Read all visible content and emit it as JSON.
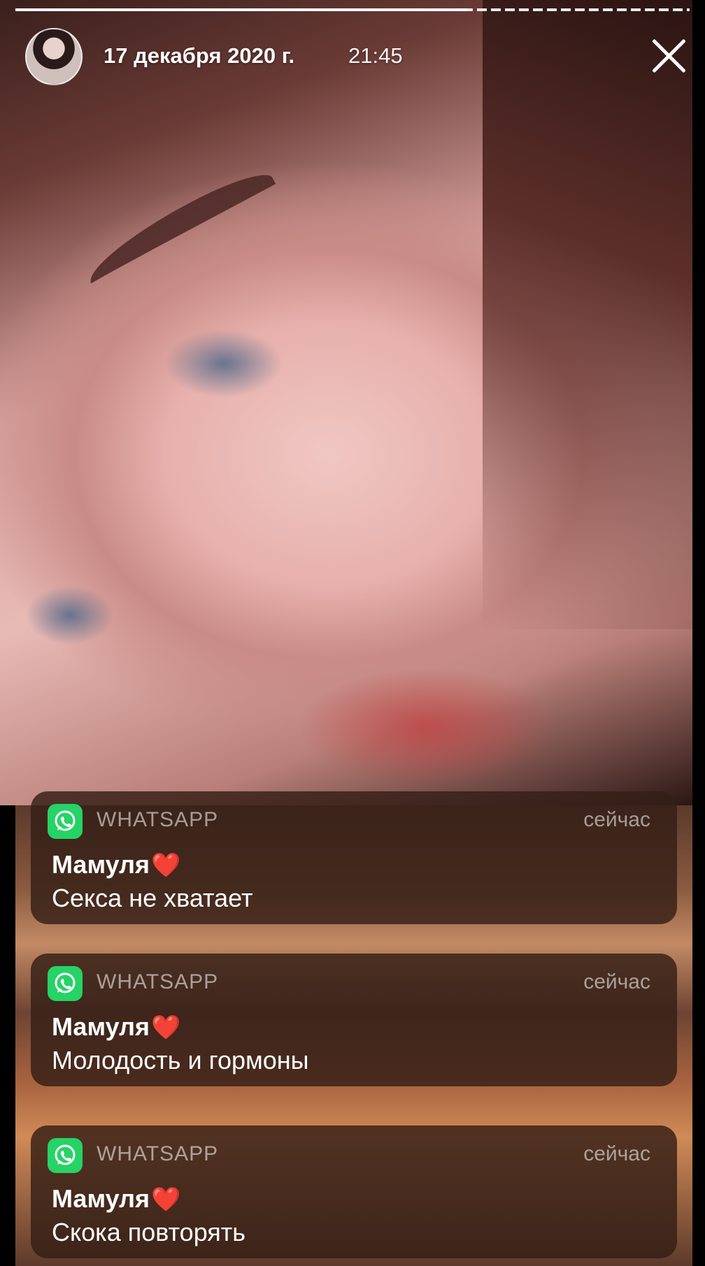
{
  "story": {
    "date": "17 декабря 2020 г.",
    "time": "21:45",
    "avatar_icon": "avatar-icon",
    "close_icon": "close-icon",
    "progress": 0.67
  },
  "notifications": [
    {
      "app_icon": "whatsapp-icon",
      "app": "WHATSAPP",
      "when": "сейчас",
      "sender": "Мамуля",
      "sender_emoji": "❤️",
      "message": "Секса не хватает"
    },
    {
      "app_icon": "whatsapp-icon",
      "app": "WHATSAPP",
      "when": "сейчас",
      "sender": "Мамуля",
      "sender_emoji": "❤️",
      "message": "Молодость и гормоны"
    },
    {
      "app_icon": "whatsapp-icon",
      "app": "WHATSAPP",
      "when": "сейчас",
      "sender": "Мамуля",
      "sender_emoji": "❤️",
      "message": "Скока повторять"
    }
  ],
  "colors": {
    "whatsapp_green": "#25d366",
    "heart_red": "#ff2d3f"
  }
}
